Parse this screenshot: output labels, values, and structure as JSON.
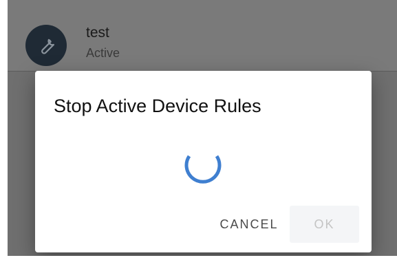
{
  "background": {
    "rule": {
      "title": "test",
      "status": "Active",
      "icon": "wrench-icon"
    }
  },
  "dialog": {
    "title": "Stop Active Device Rules",
    "loading": true,
    "spinner_color": "#3f7fd0",
    "buttons": {
      "cancel_label": "CANCEL",
      "ok_label": "OK",
      "ok_disabled": true
    }
  }
}
